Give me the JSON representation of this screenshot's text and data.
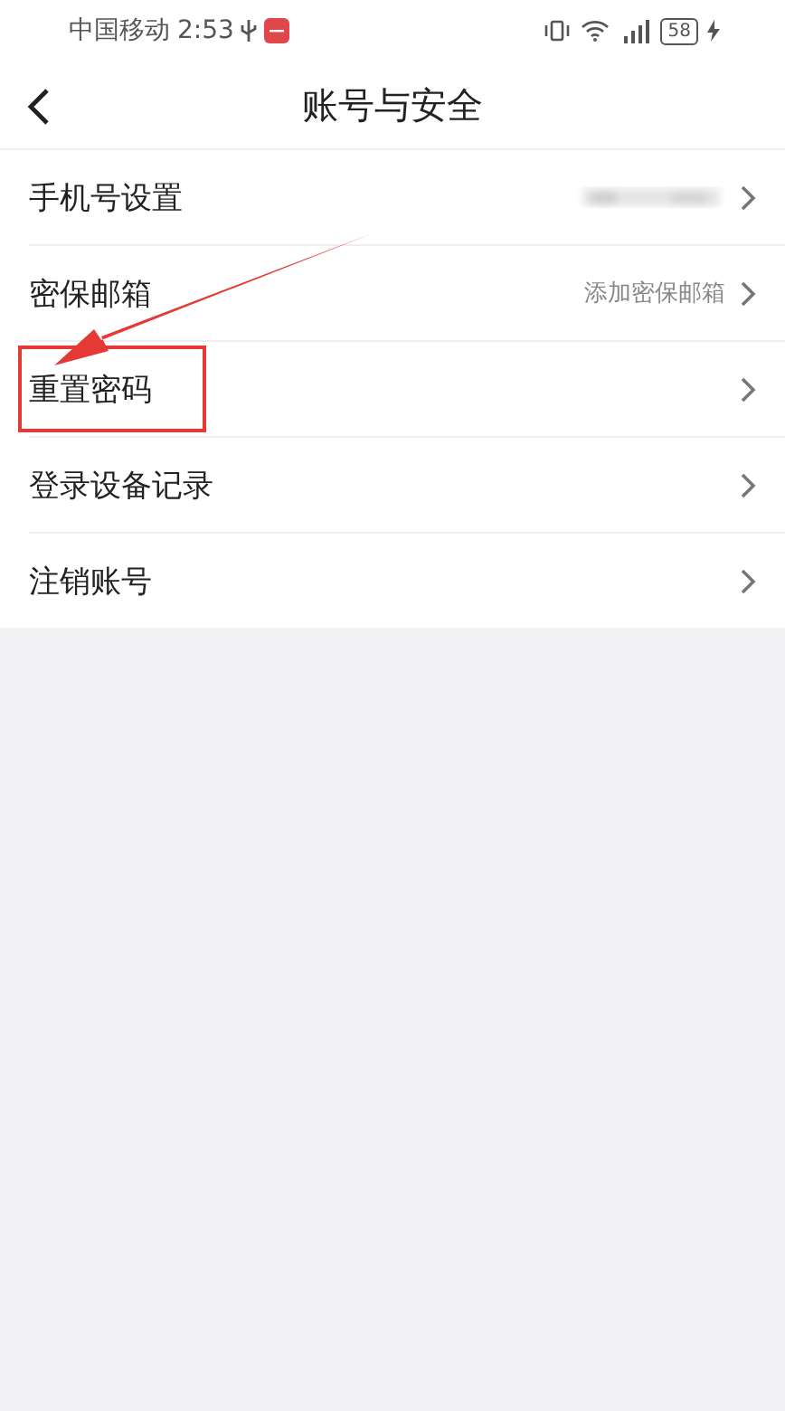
{
  "status_bar": {
    "carrier": "中国移动",
    "time": "2:53",
    "battery": "58"
  },
  "header": {
    "title": "账号与安全"
  },
  "rows": [
    {
      "label": "手机号设置",
      "kind": "redacted",
      "highlighted": false
    },
    {
      "label": "密保邮箱",
      "kind": "text",
      "value": "添加密保邮箱",
      "highlighted": false
    },
    {
      "label": "重置密码",
      "kind": "plain",
      "highlighted": true
    },
    {
      "label": "登录设备记录",
      "kind": "plain",
      "highlighted": false
    },
    {
      "label": "注销账号",
      "kind": "plain",
      "highlighted": false
    }
  ]
}
